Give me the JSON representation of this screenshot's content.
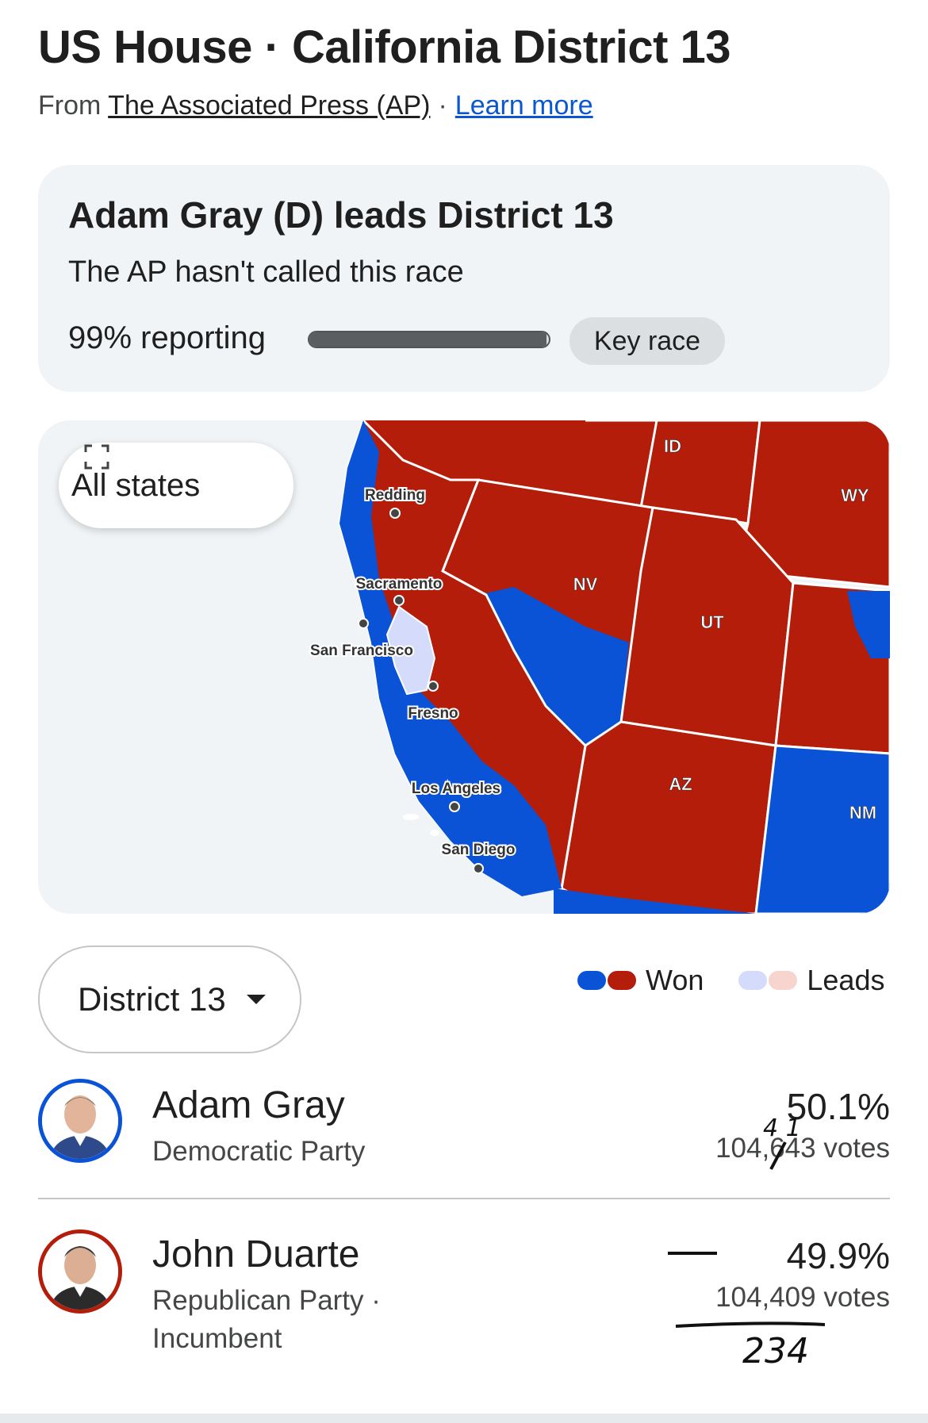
{
  "header": {
    "title": "US House · California District 13",
    "from_label": "From",
    "source": "The Associated Press (AP)",
    "separator": "·",
    "learn_more": "Learn more"
  },
  "status": {
    "headline": "Adam Gray (D) leads District 13",
    "subtext": "The AP hasn't called this race",
    "reporting_label": "99% reporting",
    "reporting_fraction": 0.99,
    "key_race": "Key race"
  },
  "map": {
    "all_states_button": "All states",
    "expand_icon": "expand-icon",
    "state_labels": [
      "ID",
      "WY",
      "NV",
      "UT",
      "AZ",
      "NM"
    ],
    "city_labels": [
      "Redding",
      "Sacramento",
      "San Francisco",
      "Fresno",
      "Los Angeles",
      "San Diego"
    ],
    "colors": {
      "dem_won": "#0a53d6",
      "rep_won": "#b31d0a",
      "dem_leads": "#d5dcfb",
      "rep_leads": "#f8d4cf",
      "background": "#f1f4f6"
    }
  },
  "controls": {
    "district_select": "District 13",
    "legend_won": "Won",
    "legend_leads": "Leads"
  },
  "candidates": [
    {
      "name": "Adam Gray",
      "party": "Democratic Party",
      "percent": "50.1%",
      "votes": "104,643 votes",
      "ring_color": "#0a53d6",
      "avatar_icon": "person-icon"
    },
    {
      "name": "John Duarte",
      "party": "Republican Party ·",
      "status": "Incumbent",
      "percent": "49.9%",
      "votes": "104,409 votes",
      "ring_color": "#b31d0a",
      "avatar_icon": "person-icon"
    }
  ],
  "handwriting": {
    "correction_digits": "4 1",
    "difference": "234"
  }
}
